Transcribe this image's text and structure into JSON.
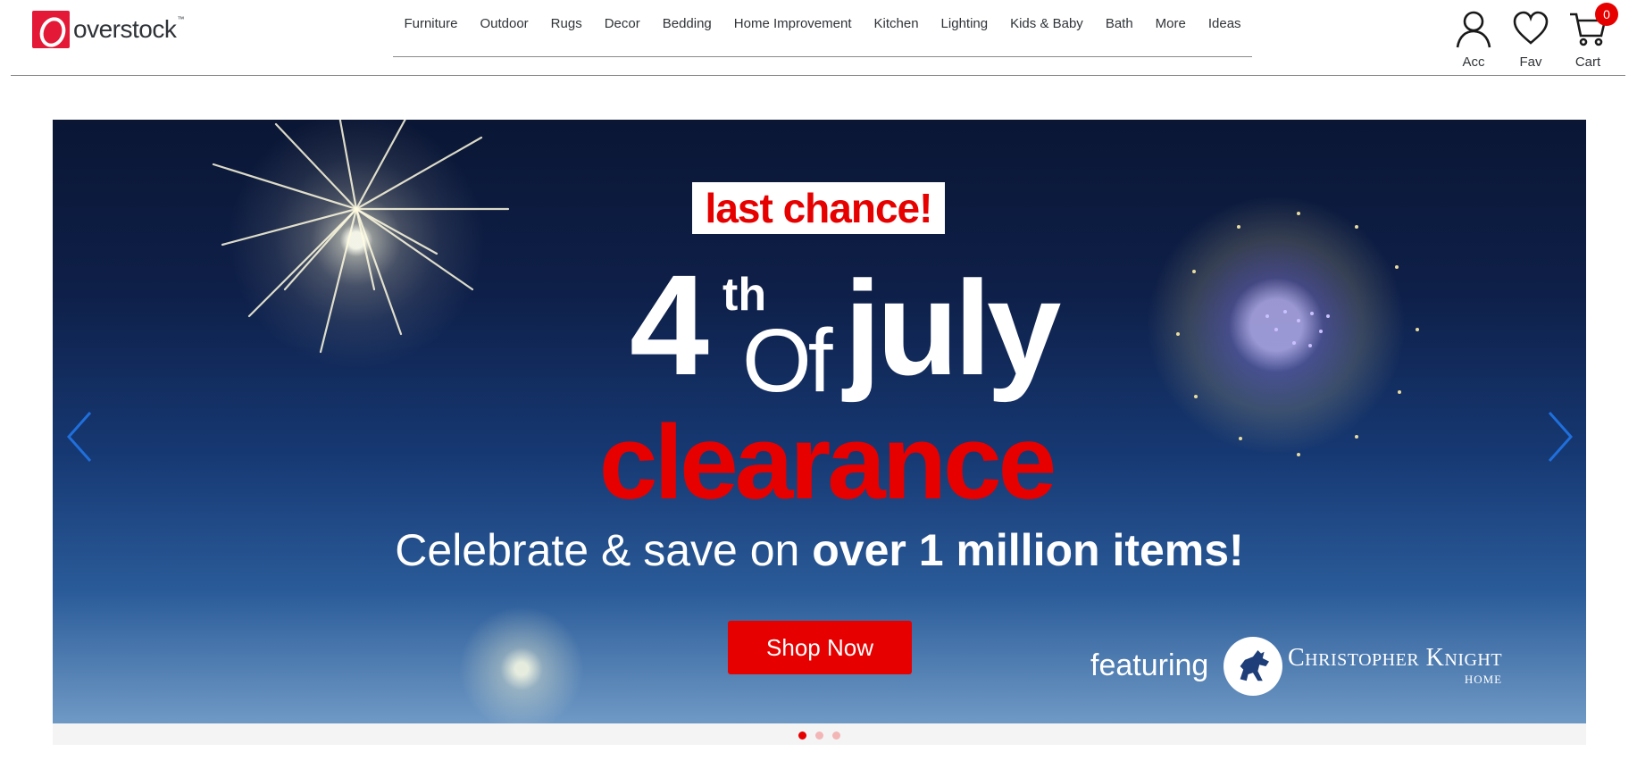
{
  "brand": {
    "logo_text": "overstock",
    "tm": "™",
    "logo_color": "#e31937"
  },
  "nav": {
    "items": [
      "Furniture",
      "Outdoor",
      "Rugs",
      "Decor",
      "Bedding",
      "Home Improvement",
      "Kitchen",
      "Lighting",
      "Kids & Baby",
      "Bath",
      "More",
      "Ideas"
    ]
  },
  "account": {
    "account_label": "Acc",
    "favorites_label": "Fav",
    "cart_label": "Cart",
    "cart_count": "0",
    "icons": {
      "account": "user-icon",
      "favorites": "heart-icon",
      "cart": "cart-icon"
    }
  },
  "hero": {
    "badge": "last chance!",
    "headline_number": "4",
    "headline_suffix": "th",
    "headline_of": "Of",
    "headline_word": "july",
    "headline_accent": "clearance",
    "subtitle_regular": "Celebrate & save on ",
    "subtitle_bold": "over 1 million items!",
    "cta_label": "Shop Now",
    "featuring_label": "featuring",
    "partner_name": "Christopher Knight",
    "partner_sub": "HOME",
    "accent_color": "#e60000",
    "slides": {
      "count": 3,
      "active": 0
    },
    "icons": {
      "prev": "chevron-left-icon",
      "next": "chevron-right-icon",
      "partner": "horse-logo-icon"
    }
  }
}
